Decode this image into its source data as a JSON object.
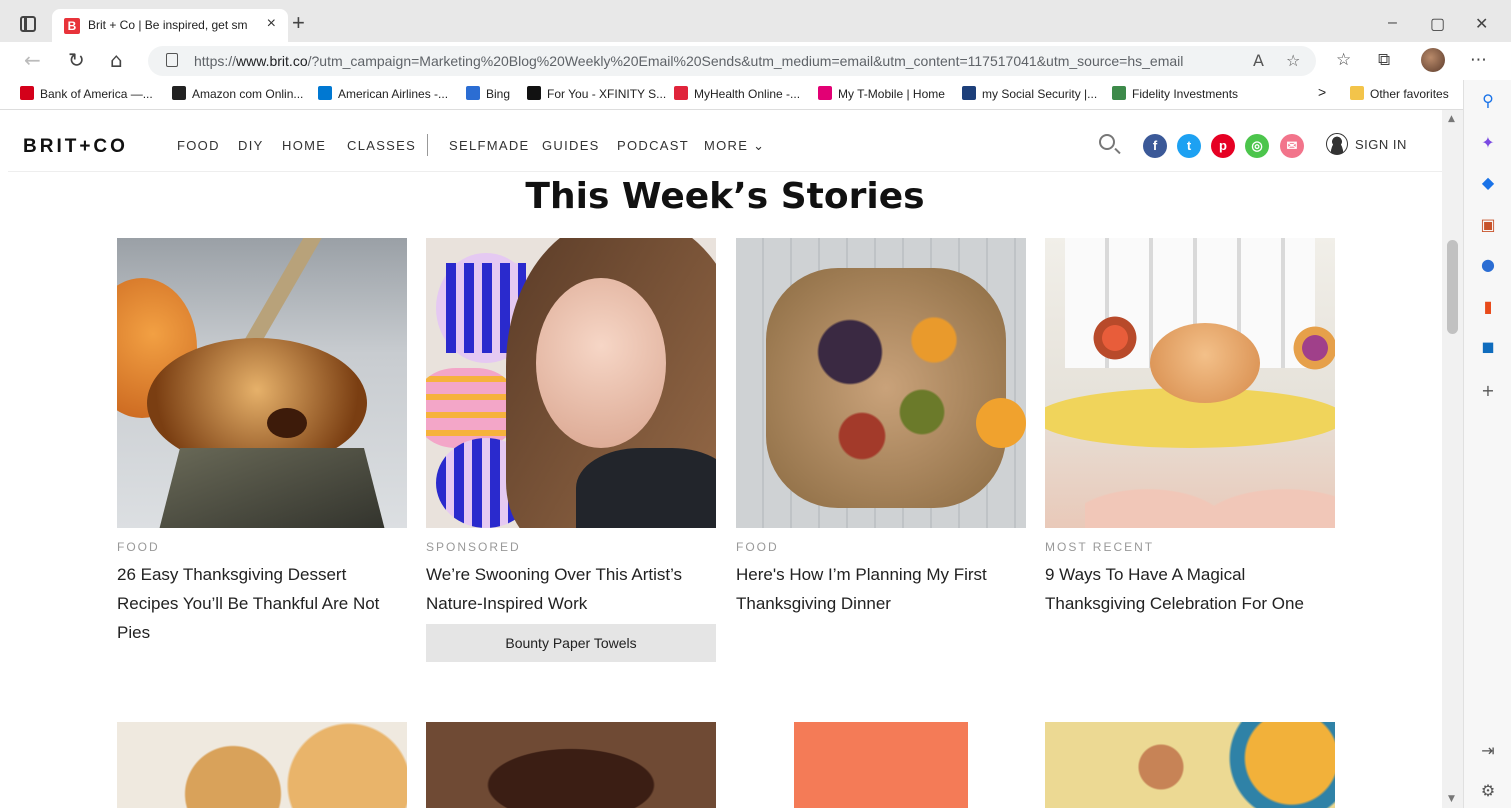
{
  "browser": {
    "tab": {
      "favicon": "B",
      "title": "Brit + Co | Be inspired, get smart",
      "close": "×"
    },
    "new_tab": "+",
    "window_controls": {
      "minimize": "–",
      "restore": "▢",
      "close": "✕"
    },
    "address": {
      "url_prefix": "https://",
      "url_domain": "www.brit.co",
      "url_rest": "/?utm_campaign=Marketing%20Blog%20Weekly%20Email%20Sends&utm_medium=email&utm_content=117517041&utm_source=hs_email"
    },
    "bookmarks": [
      {
        "label": "Bank of America —...",
        "color": "#d4001a"
      },
      {
        "label": "Amazon com  Onlin...",
        "color": "#222222"
      },
      {
        "label": "American Airlines -...",
        "color": "#0078d2"
      },
      {
        "label": "Bing",
        "color": "#2b6dd3"
      },
      {
        "label": "For You - XFINITY S...",
        "color": "#111111"
      },
      {
        "label": "MyHealth Online -...",
        "color": "#e0243b"
      },
      {
        "label": "My T-Mobile | Home",
        "color": "#e20074"
      },
      {
        "label": "my Social Security |...",
        "color": "#1d3f7a"
      },
      {
        "label": "Fidelity Investments",
        "color": "#3d8a4a"
      }
    ],
    "bookmarks_more": ">",
    "other_favorites": "Other favorites"
  },
  "site": {
    "logo": "BRIT+CO",
    "nav": [
      "FOOD",
      "DIY",
      "HOME",
      "CLASSES",
      "SELFMADE",
      "GUIDES",
      "PODCAST",
      "MORE ⌄"
    ],
    "social": [
      {
        "name": "facebook",
        "glyph": "f",
        "color": "#3b5998"
      },
      {
        "name": "twitter",
        "glyph": "t",
        "color": "#1da1f2"
      },
      {
        "name": "pinterest",
        "glyph": "p",
        "color": "#e60023"
      },
      {
        "name": "instagram",
        "glyph": "◎",
        "color": "#4cc54c"
      },
      {
        "name": "email",
        "glyph": "✉",
        "color": "#f2748b"
      }
    ],
    "sign_in": "SIGN IN"
  },
  "section": {
    "title": "This Week’s Stories",
    "cards": [
      {
        "category": "FOOD",
        "headline": "26 Easy Thanksgiving Dessert Recipes You’ll Be Thankful Are Not Pies"
      },
      {
        "category": "SPONSORED",
        "headline": "We’re Swooning Over This Artist’s Nature-Inspired Work",
        "sponsor": "Bounty Paper Towels"
      },
      {
        "category": "FOOD",
        "headline": "Here's How I’m Planning My First Thanksgiving Dinner"
      },
      {
        "category": "MOST RECENT",
        "headline": "9 Ways To Have A Magical Thanksgiving Celebration For One"
      }
    ]
  }
}
